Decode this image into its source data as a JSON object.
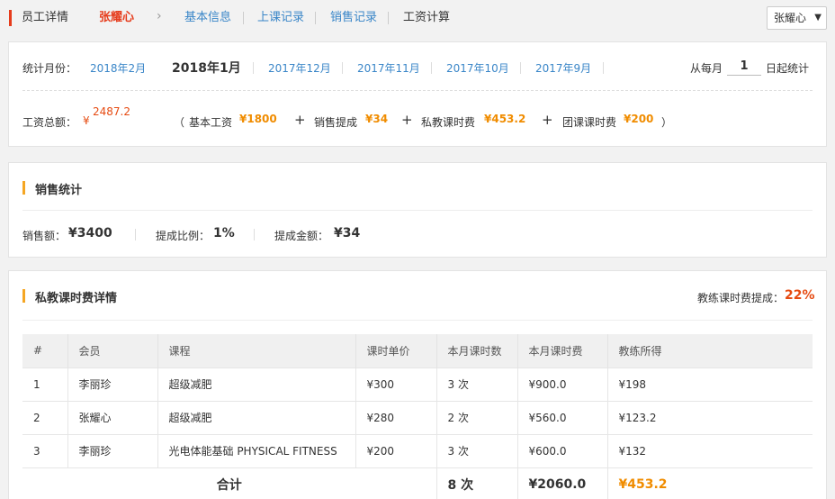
{
  "topnav": {
    "title": "员工详情",
    "employee_name": "张耀心",
    "tabs": [
      {
        "label": "基本信息"
      },
      {
        "label": "上课记录"
      },
      {
        "label": "销售记录"
      },
      {
        "label": "工资计算"
      }
    ],
    "employee_select": "张耀心"
  },
  "salary": {
    "month_label": "统计月份：",
    "months": [
      "2018年2月",
      "2018年1月",
      "2017年12月",
      "2017年11月",
      "2017年10月",
      "2017年9月"
    ],
    "selected_month": "2018年1月",
    "from_label": "从每月",
    "day_value": "1",
    "day_suffix": "日起统计",
    "total_label": "工资总额：",
    "currency": "¥",
    "total_value": "2487.2",
    "paren_open": "（",
    "paren_close": "）",
    "base_label": "基本工资",
    "base_value": "¥1800",
    "plus": "+",
    "sales_label": "销售提成",
    "sales_value": "¥34",
    "private_label": "私教课时费",
    "private_value": "¥453.2",
    "group_label": "团课课时费",
    "group_value": "¥200"
  },
  "sales": {
    "title": "销售统计",
    "amount_label": "销售额：",
    "amount_value": "¥3400",
    "ratio_label": "提成比例：",
    "ratio_value": "1%",
    "commission_label": "提成金额：",
    "commission_value": "¥34"
  },
  "private": {
    "title": "私教课时费详情",
    "rate_label": "教练课时费提成：",
    "rate_value": "22%",
    "columns": [
      "#",
      "会员",
      "课程",
      "课时单价",
      "本月课时数",
      "本月课时费",
      "教练所得"
    ],
    "rows": [
      {
        "no": "1",
        "member": "李丽珍",
        "course": "超级减肥",
        "price": "¥300",
        "count": "3 次",
        "fee": "¥900.0",
        "earn": "¥198"
      },
      {
        "no": "2",
        "member": "张耀心",
        "course": "超级减肥",
        "price": "¥280",
        "count": "2 次",
        "fee": "¥560.0",
        "earn": "¥123.2"
      },
      {
        "no": "3",
        "member": "李丽珍",
        "course": "光电体能基础 PHYSICAL FITNESS",
        "price": "¥200",
        "count": "3 次",
        "fee": "¥600.0",
        "earn": "¥132"
      }
    ],
    "total": {
      "label": "合计",
      "count": "8 次",
      "fee": "¥2060.0",
      "earn": "¥453.2"
    }
  },
  "colors": {
    "accent_red": "#e64b12",
    "accent_orange": "#f08c00",
    "link_blue": "#3a86c8",
    "section_bar": "#f5a623"
  }
}
